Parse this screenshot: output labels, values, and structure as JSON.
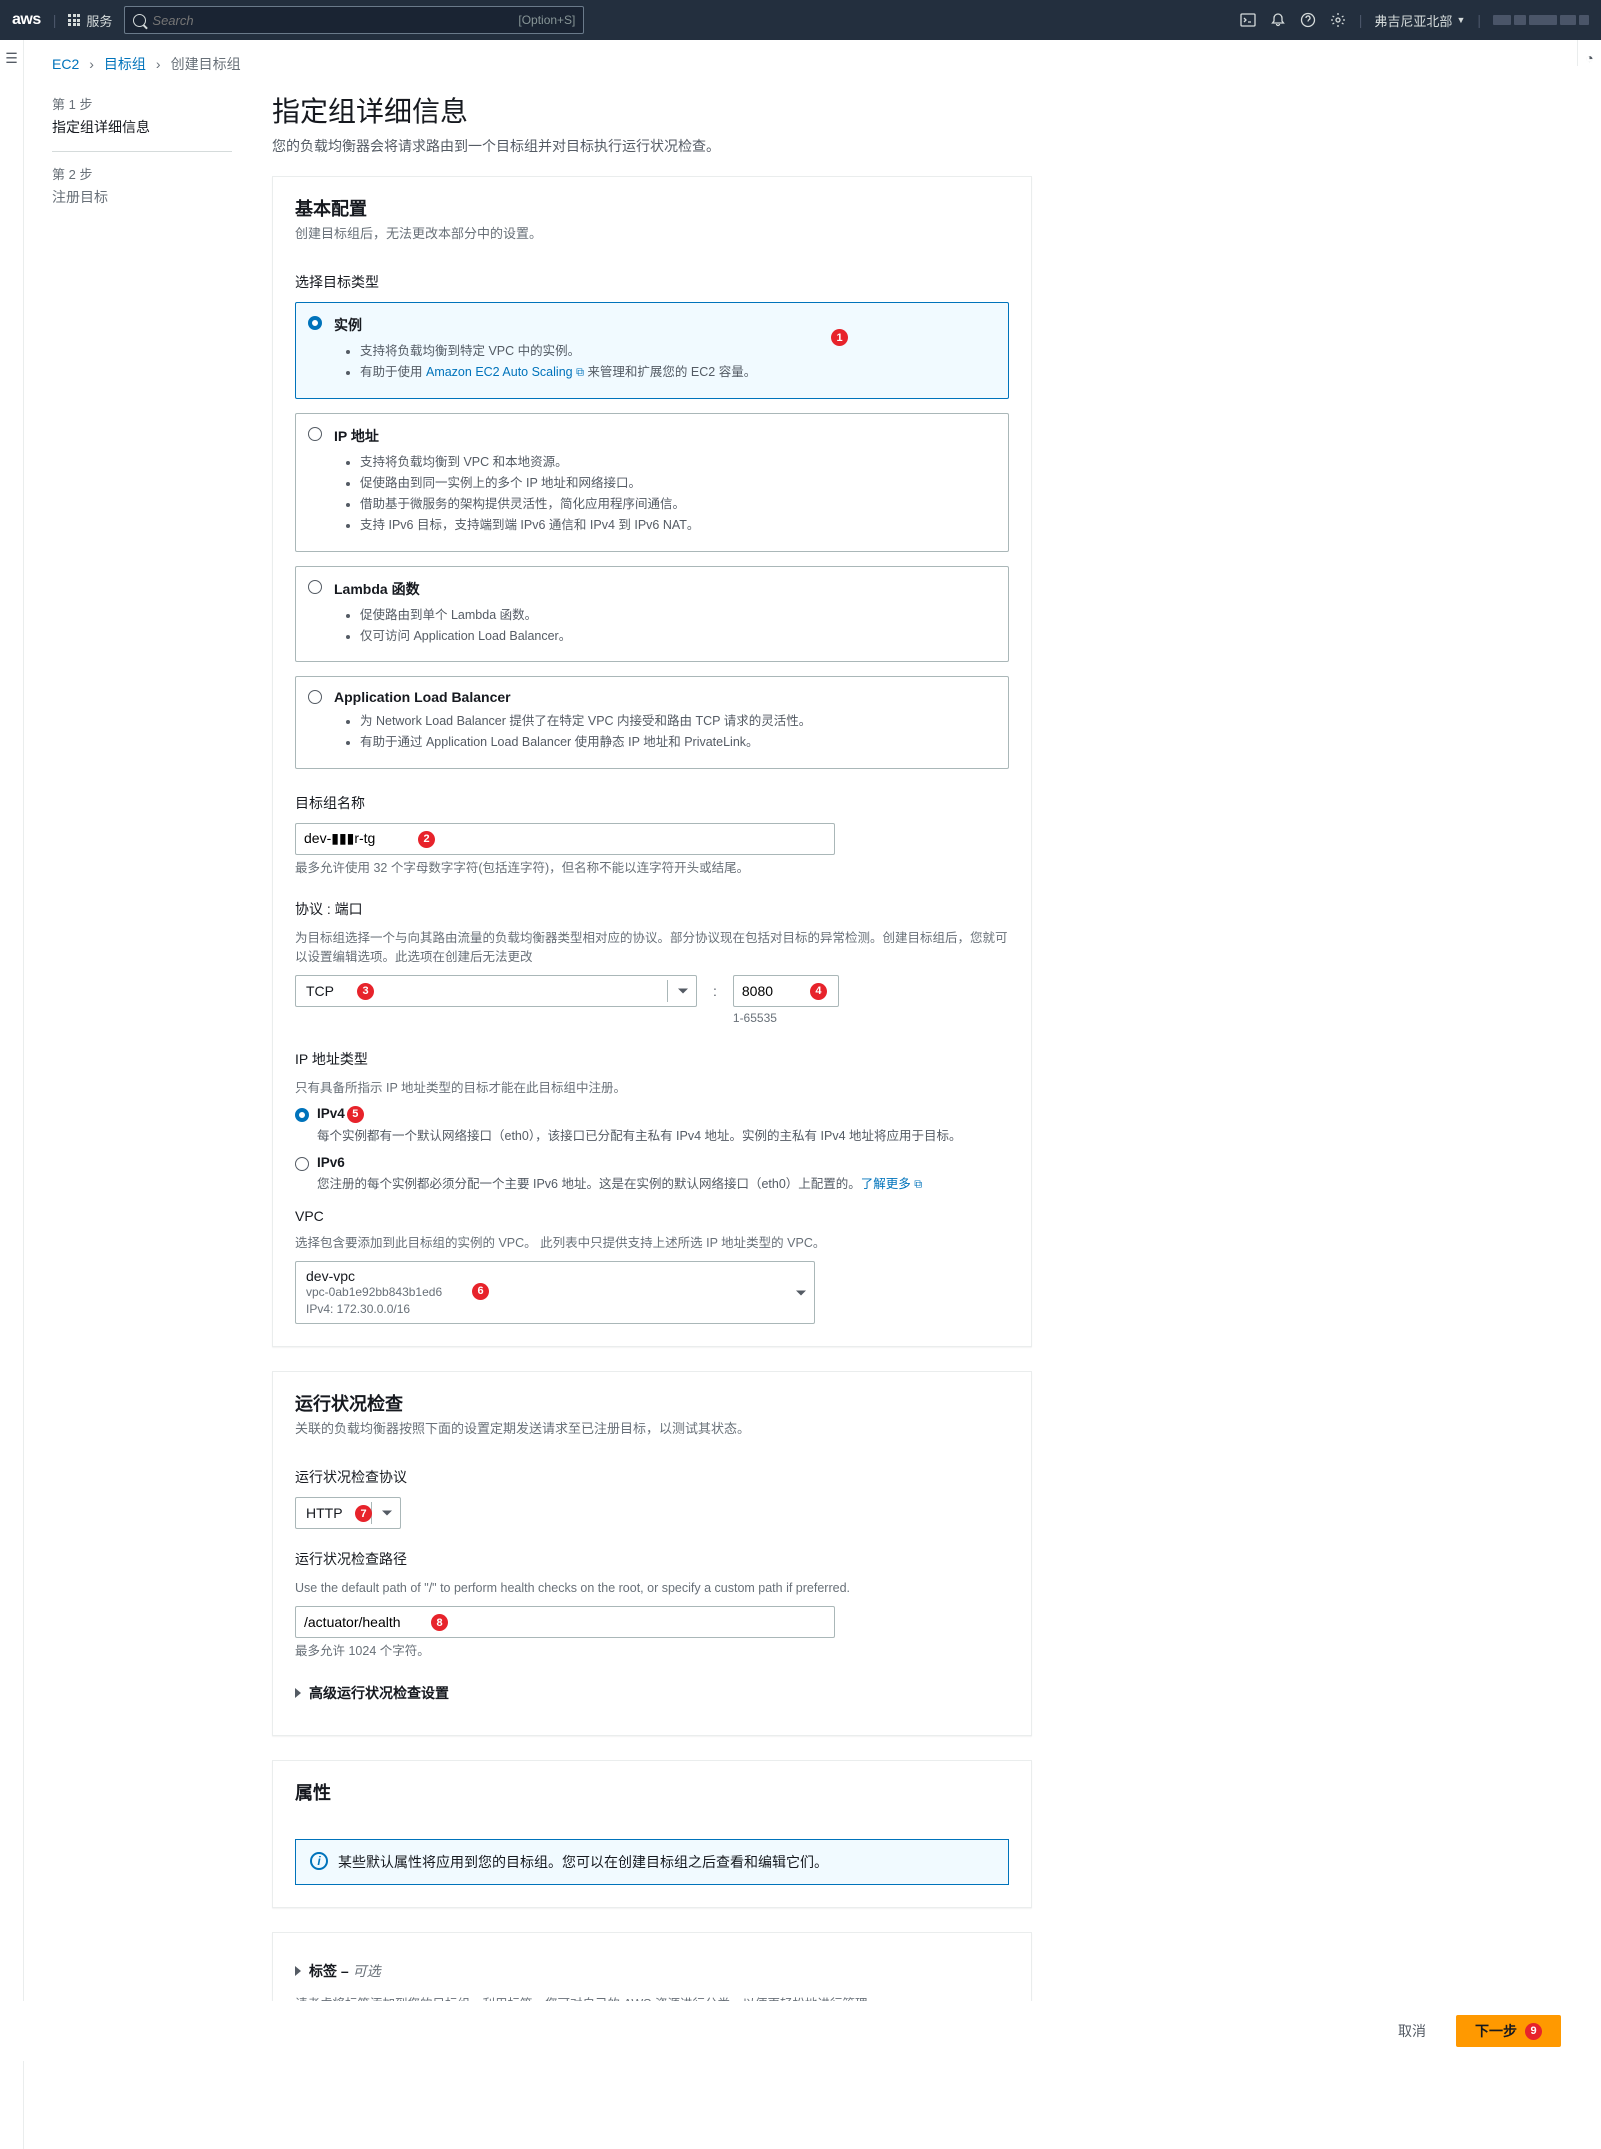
{
  "nav": {
    "logo": "aws",
    "services": "服务",
    "search_placeholder": "Search",
    "kbd": "[Option+S]",
    "region": "弗吉尼亚北部"
  },
  "breadcrumb": {
    "items": [
      "EC2",
      "目标组",
      "创建目标组"
    ]
  },
  "steps": {
    "s1_label": "第 1 步",
    "s1_title": "指定组详细信息",
    "s2_label": "第 2 步",
    "s2_title": "注册目标"
  },
  "page": {
    "title": "指定组详细信息",
    "desc": "您的负载均衡器会将请求路由到一个目标组并对目标执行运行状况检查。"
  },
  "basic": {
    "heading": "基本配置",
    "sub": "创建目标组后，无法更改本部分中的设置。",
    "choose_type": "选择目标类型",
    "types": {
      "inst": {
        "title": "实例",
        "b1": "支持将负载均衡到特定 VPC 中的实例。",
        "b2a": "有助于使用 ",
        "b2link": "Amazon EC2 Auto Scaling",
        "b2b": " 来管理和扩展您的 EC2 容量。"
      },
      "ip": {
        "title": "IP 地址",
        "b1": "支持将负载均衡到 VPC 和本地资源。",
        "b2": "促使路由到同一实例上的多个 IP 地址和网络接口。",
        "b3": "借助基于微服务的架构提供灵活性，简化应用程序间通信。",
        "b4": "支持 IPv6 目标，支持端到端 IPv6 通信和 IPv4 到 IPv6 NAT。"
      },
      "lambda": {
        "title": "Lambda 函数",
        "b1": "促使路由到单个 Lambda 函数。",
        "b2": "仅可访问 Application Load Balancer。"
      },
      "alb": {
        "title": "Application Load Balancer",
        "b1": "为 Network Load Balancer 提供了在特定 VPC 内接受和路由 TCP 请求的灵活性。",
        "b2": "有助于通过 Application Load Balancer 使用静态 IP 地址和 PrivateLink。"
      }
    },
    "tg_name_label": "目标组名称",
    "tg_name_value": "dev-▮▮▮r-tg",
    "tg_name_hint": "最多允许使用 32 个字母数字字符(包括连字符)，但名称不能以连字符开头或结尾。",
    "proto_label": "协议 : 端口",
    "proto_desc": "为目标组选择一个与向其路由流量的负载均衡器类型相对应的协议。部分协议现在包括对目标的异常检测。创建目标组后，您就可以设置编辑选项。此选项在创建后无法更改",
    "proto_value": "TCP",
    "port_value": "8080",
    "port_range": "1-65535",
    "ip_type_label": "IP 地址类型",
    "ip_type_desc": "只有具备所指示 IP 地址类型的目标才能在此目标组中注册。",
    "ipv4_label": "IPv4",
    "ipv4_desc": "每个实例都有一个默认网络接口（eth0），该接口已分配有主私有 IPv4 地址。实例的主私有 IPv4 地址将应用于目标。",
    "ipv6_label": "IPv6",
    "ipv6_desc_a": "您注册的每个实例都必须分配一个主要 IPv6 地址。这是在实例的默认网络接口（eth0）上配置的。",
    "ipv6_link": "了解更多",
    "vpc_label": "VPC",
    "vpc_desc": "选择包含要添加到此目标组的实例的 VPC。 此列表中只提供支持上述所选 IP 地址类型的 VPC。",
    "vpc_name": "dev-vpc",
    "vpc_id": "vpc-0ab1e92bb843b1ed6",
    "vpc_cidr": "IPv4: 172.30.0.0/16"
  },
  "hc": {
    "heading": "运行状况检查",
    "sub": "关联的负载均衡器按照下面的设置定期发送请求至已注册目标，以测试其状态。",
    "proto_label": "运行状况检查协议",
    "proto_value": "HTTP",
    "path_label": "运行状况检查路径",
    "path_desc": "Use the default path of \"/\" to perform health checks on the root, or specify a custom path if preferred.",
    "path_value": "/actuator/health",
    "path_hint": "最多允许 1024 个字符。",
    "adv_label": "高级运行状况检查设置"
  },
  "attrs": {
    "heading": "属性",
    "info": "某些默认属性将应用到您的目标组。您可以在创建目标组之后查看和编辑它们。"
  },
  "tags": {
    "heading_a": "标签 – ",
    "heading_b": "可选",
    "desc": "请考虑将标签添加到您的目标组。利用标签，您可对自己的 AWS 资源进行分类，以便更轻松地进行管理。"
  },
  "footer": {
    "cancel": "取消",
    "next": "下一步"
  },
  "badges": {
    "b1": "1",
    "b2": "2",
    "b3": "3",
    "b4": "4",
    "b5": "5",
    "b6": "6",
    "b7": "7",
    "b8": "8",
    "b9": "9"
  }
}
